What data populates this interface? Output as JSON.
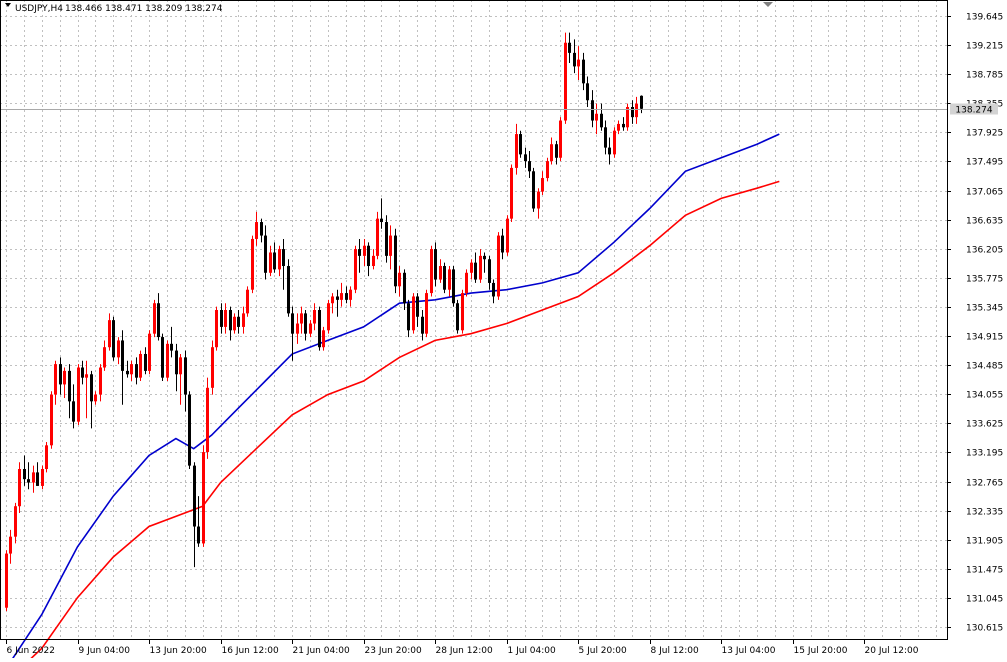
{
  "header": {
    "symbol_tf": "USDJPY,H4",
    "ohlc": "138.466 138.471 138.209 138.274"
  },
  "price_label": {
    "value": "138.274",
    "bg": "#d3d3d3"
  },
  "colors": {
    "bull": "#ff0000",
    "bear": "#000000",
    "ma_fast": "#0000cd",
    "ma_slow": "#ff0000",
    "grid": "#c0c0c0"
  },
  "chart_data": {
    "type": "candlestick",
    "symbol": "USDJPY",
    "timeframe": "H4",
    "ylim": [
      130.4,
      139.85
    ],
    "y_ticks": [
      "139.645",
      "139.215",
      "138.785",
      "138.355",
      "137.925",
      "137.495",
      "137.065",
      "136.635",
      "136.205",
      "135.775",
      "135.345",
      "134.915",
      "134.485",
      "134.055",
      "133.625",
      "133.195",
      "132.765",
      "132.335",
      "131.905",
      "131.475",
      "131.045",
      "130.615"
    ],
    "x_ticks": [
      "6 Jun 2022",
      "9 Jun 04:00",
      "13 Jun 20:00",
      "16 Jun 12:00",
      "21 Jun 04:00",
      "23 Jun 20:00",
      "28 Jun 12:00",
      "1 Jul 04:00",
      "5 Jul 20:00",
      "8 Jul 12:00",
      "13 Jul 04:00",
      "15 Jul 20:00",
      "20 Jul 12:00"
    ],
    "x_tick_bars": [
      0,
      16,
      32,
      48,
      64,
      80,
      96,
      112,
      128,
      144,
      160,
      176,
      192
    ],
    "last_price": 138.274,
    "candles": [
      [
        130.9,
        131.75,
        130.85,
        131.7
      ],
      [
        131.7,
        132.05,
        131.55,
        131.95
      ],
      [
        131.95,
        132.45,
        131.85,
        132.4
      ],
      [
        132.4,
        133.05,
        132.3,
        132.95
      ],
      [
        132.95,
        133.15,
        132.7,
        132.8
      ],
      [
        132.8,
        133.05,
        132.65,
        132.75
      ],
      [
        132.75,
        133.0,
        132.6,
        132.9
      ],
      [
        132.9,
        133.05,
        132.7,
        132.7
      ],
      [
        132.7,
        133.0,
        132.65,
        132.95
      ],
      [
        132.95,
        133.35,
        132.9,
        133.3
      ],
      [
        133.3,
        134.1,
        133.25,
        134.05
      ],
      [
        134.05,
        134.55,
        133.9,
        134.5
      ],
      [
        134.5,
        134.6,
        134.05,
        134.2
      ],
      [
        134.2,
        134.45,
        134.0,
        134.4
      ],
      [
        134.4,
        134.5,
        133.7,
        133.95
      ],
      [
        133.95,
        134.2,
        133.55,
        133.65
      ],
      [
        133.65,
        134.5,
        133.6,
        134.45
      ],
      [
        134.45,
        134.55,
        134.2,
        134.3
      ],
      [
        134.3,
        134.55,
        133.7,
        134.35
      ],
      [
        134.35,
        134.4,
        133.55,
        133.95
      ],
      [
        133.95,
        134.1,
        133.9,
        134.05
      ],
      [
        134.05,
        134.5,
        133.95,
        134.45
      ],
      [
        134.45,
        134.85,
        134.4,
        134.75
      ],
      [
        134.75,
        135.25,
        134.7,
        135.15
      ],
      [
        135.15,
        135.2,
        134.55,
        134.6
      ],
      [
        134.6,
        134.9,
        134.5,
        134.85
      ],
      [
        134.85,
        135.0,
        133.9,
        134.4
      ],
      [
        134.4,
        134.55,
        134.3,
        134.35
      ],
      [
        134.35,
        134.55,
        134.25,
        134.5
      ],
      [
        134.5,
        134.6,
        134.2,
        134.3
      ],
      [
        134.3,
        134.7,
        134.25,
        134.65
      ],
      [
        134.65,
        134.75,
        134.35,
        134.4
      ],
      [
        134.4,
        135.0,
        134.35,
        134.95
      ],
      [
        134.95,
        135.45,
        134.9,
        135.4
      ],
      [
        135.4,
        135.55,
        134.85,
        134.9
      ],
      [
        134.9,
        134.95,
        134.25,
        134.3
      ],
      [
        134.3,
        134.85,
        134.25,
        134.8
      ],
      [
        134.8,
        135.05,
        134.6,
        134.7
      ],
      [
        134.7,
        134.8,
        134.1,
        134.35
      ],
      [
        134.35,
        134.65,
        133.9,
        134.6
      ],
      [
        134.6,
        134.7,
        133.8,
        134.05
      ],
      [
        134.05,
        134.1,
        132.95,
        133.0
      ],
      [
        133.0,
        133.05,
        131.5,
        132.1
      ],
      [
        132.1,
        132.55,
        131.8,
        131.85
      ],
      [
        131.85,
        133.3,
        131.8,
        133.2
      ],
      [
        133.2,
        134.3,
        133.1,
        134.15
      ],
      [
        134.15,
        134.85,
        134.05,
        134.75
      ],
      [
        134.75,
        135.35,
        134.7,
        135.3
      ],
      [
        135.3,
        135.4,
        134.95,
        135.05
      ],
      [
        135.05,
        135.4,
        134.95,
        135.3
      ],
      [
        135.3,
        135.35,
        134.85,
        135.0
      ],
      [
        135.0,
        135.25,
        134.95,
        135.2
      ],
      [
        135.2,
        135.3,
        134.95,
        135.05
      ],
      [
        135.05,
        135.35,
        134.95,
        135.25
      ],
      [
        135.25,
        135.65,
        135.2,
        135.6
      ],
      [
        135.6,
        136.4,
        135.55,
        136.35
      ],
      [
        136.35,
        136.75,
        136.25,
        136.6
      ],
      [
        136.6,
        136.65,
        136.3,
        136.4
      ],
      [
        136.4,
        136.55,
        135.75,
        135.85
      ],
      [
        135.85,
        136.25,
        135.8,
        136.15
      ],
      [
        136.15,
        136.3,
        135.85,
        135.9
      ],
      [
        135.9,
        136.25,
        135.8,
        136.2
      ],
      [
        136.2,
        136.35,
        135.6,
        135.95
      ],
      [
        135.95,
        136.05,
        135.2,
        135.25
      ],
      [
        135.25,
        135.35,
        134.55,
        134.95
      ],
      [
        134.95,
        135.25,
        134.8,
        135.1
      ],
      [
        135.1,
        135.35,
        134.95,
        135.25
      ],
      [
        135.25,
        135.3,
        134.85,
        134.95
      ],
      [
        134.95,
        135.15,
        134.9,
        135.1
      ],
      [
        135.1,
        135.4,
        135.0,
        135.3
      ],
      [
        135.3,
        135.35,
        134.7,
        134.75
      ],
      [
        134.75,
        135.05,
        134.7,
        135.0
      ],
      [
        135.0,
        135.45,
        134.95,
        135.4
      ],
      [
        135.4,
        135.55,
        135.25,
        135.5
      ],
      [
        135.5,
        135.6,
        135.2,
        135.45
      ],
      [
        135.45,
        135.7,
        135.35,
        135.55
      ],
      [
        135.55,
        135.65,
        135.4,
        135.45
      ],
      [
        135.45,
        135.65,
        135.35,
        135.6
      ],
      [
        135.6,
        136.25,
        135.55,
        136.2
      ],
      [
        136.2,
        136.35,
        135.85,
        136.1
      ],
      [
        136.1,
        136.35,
        135.95,
        136.25
      ],
      [
        136.25,
        136.3,
        135.8,
        135.95
      ],
      [
        135.95,
        136.2,
        135.9,
        136.1
      ],
      [
        136.1,
        136.75,
        136.05,
        136.65
      ],
      [
        136.65,
        136.95,
        136.5,
        136.6
      ],
      [
        136.6,
        136.7,
        136.0,
        136.1
      ],
      [
        136.1,
        136.55,
        135.9,
        136.4
      ],
      [
        136.4,
        136.5,
        135.55,
        135.65
      ],
      [
        135.65,
        135.95,
        135.5,
        135.85
      ],
      [
        135.85,
        135.9,
        135.3,
        135.4
      ],
      [
        135.4,
        135.45,
        134.9,
        135.0
      ],
      [
        135.0,
        135.55,
        134.95,
        135.5
      ],
      [
        135.5,
        135.55,
        135.05,
        135.2
      ],
      [
        135.2,
        135.3,
        134.85,
        134.95
      ],
      [
        134.95,
        135.6,
        134.9,
        135.55
      ],
      [
        135.55,
        136.25,
        135.5,
        136.2
      ],
      [
        136.2,
        136.3,
        135.65,
        135.75
      ],
      [
        135.75,
        136.05,
        135.7,
        135.95
      ],
      [
        135.95,
        136.0,
        135.55,
        135.6
      ],
      [
        135.6,
        135.95,
        135.5,
        135.9
      ],
      [
        135.9,
        135.95,
        135.35,
        135.4
      ],
      [
        135.4,
        135.45,
        134.95,
        135.0
      ],
      [
        135.0,
        135.6,
        134.95,
        135.55
      ],
      [
        135.55,
        135.9,
        135.5,
        135.85
      ],
      [
        135.85,
        136.05,
        135.75,
        136.0
      ],
      [
        136.0,
        136.15,
        135.7,
        135.75
      ],
      [
        135.75,
        136.2,
        135.7,
        136.1
      ],
      [
        136.1,
        136.15,
        135.85,
        136.05
      ],
      [
        136.05,
        136.1,
        135.6,
        135.7
      ],
      [
        135.7,
        135.75,
        135.4,
        135.5
      ],
      [
        135.5,
        136.45,
        135.45,
        136.4
      ],
      [
        136.4,
        136.5,
        136.05,
        136.15
      ],
      [
        136.15,
        136.7,
        136.1,
        136.65
      ],
      [
        136.65,
        137.45,
        136.6,
        137.4
      ],
      [
        137.4,
        138.05,
        137.3,
        137.9
      ],
      [
        137.9,
        137.95,
        137.55,
        137.6
      ],
      [
        137.6,
        137.7,
        137.4,
        137.5
      ],
      [
        137.5,
        137.65,
        137.25,
        137.35
      ],
      [
        137.35,
        137.4,
        136.75,
        136.8
      ],
      [
        136.8,
        137.1,
        136.65,
        137.05
      ],
      [
        137.05,
        137.35,
        137.0,
        137.25
      ],
      [
        137.25,
        137.55,
        137.2,
        137.5
      ],
      [
        137.5,
        137.85,
        137.45,
        137.75
      ],
      [
        137.75,
        137.8,
        137.45,
        137.55
      ],
      [
        137.55,
        138.15,
        137.5,
        138.1
      ],
      [
        138.1,
        139.4,
        138.05,
        139.25
      ],
      [
        139.25,
        139.4,
        138.95,
        139.1
      ],
      [
        139.1,
        139.3,
        138.8,
        138.9
      ],
      [
        138.9,
        139.2,
        138.7,
        139.0
      ],
      [
        139.0,
        139.1,
        138.55,
        138.65
      ],
      [
        138.65,
        138.75,
        138.3,
        138.4
      ],
      [
        138.4,
        138.55,
        138.0,
        138.1
      ],
      [
        138.1,
        138.35,
        137.9,
        138.2
      ],
      [
        138.2,
        138.35,
        137.95,
        138.0
      ],
      [
        138.0,
        138.1,
        137.6,
        137.7
      ],
      [
        137.7,
        137.85,
        137.45,
        137.6
      ],
      [
        137.6,
        138.0,
        137.55,
        137.95
      ],
      [
        137.95,
        138.1,
        137.9,
        138.05
      ],
      [
        138.05,
        138.15,
        137.95,
        138.0
      ],
      [
        138.0,
        138.35,
        137.95,
        138.3
      ],
      [
        138.3,
        138.4,
        138.05,
        138.15
      ],
      [
        138.15,
        138.45,
        138.05,
        138.35
      ],
      [
        138.466,
        138.471,
        138.209,
        138.274
      ]
    ],
    "series": [
      {
        "name": "MA fast",
        "color": "#0000cd",
        "values": [
          [
            0,
            130.0
          ],
          [
            8,
            130.8
          ],
          [
            16,
            131.8
          ],
          [
            24,
            132.55
          ],
          [
            32,
            133.15
          ],
          [
            38,
            133.4
          ],
          [
            42,
            133.25
          ],
          [
            46,
            133.45
          ],
          [
            52,
            133.85
          ],
          [
            58,
            134.25
          ],
          [
            64,
            134.65
          ],
          [
            72,
            134.85
          ],
          [
            80,
            135.05
          ],
          [
            88,
            135.4
          ],
          [
            96,
            135.45
          ],
          [
            104,
            135.55
          ],
          [
            112,
            135.6
          ],
          [
            120,
            135.7
          ],
          [
            128,
            135.85
          ],
          [
            136,
            136.3
          ],
          [
            144,
            136.8
          ],
          [
            152,
            137.35
          ],
          [
            160,
            137.55
          ],
          [
            168,
            137.75
          ],
          [
            173,
            137.9
          ]
        ]
      },
      {
        "name": "MA slow",
        "color": "#ff0000",
        "values": [
          [
            0,
            129.8
          ],
          [
            8,
            130.3
          ],
          [
            16,
            131.05
          ],
          [
            24,
            131.65
          ],
          [
            32,
            132.1
          ],
          [
            40,
            132.3
          ],
          [
            44,
            132.4
          ],
          [
            48,
            132.75
          ],
          [
            56,
            133.25
          ],
          [
            64,
            133.75
          ],
          [
            72,
            134.05
          ],
          [
            80,
            134.25
          ],
          [
            88,
            134.6
          ],
          [
            96,
            134.85
          ],
          [
            104,
            134.95
          ],
          [
            112,
            135.1
          ],
          [
            120,
            135.3
          ],
          [
            128,
            135.5
          ],
          [
            136,
            135.85
          ],
          [
            144,
            136.25
          ],
          [
            152,
            136.7
          ],
          [
            160,
            136.95
          ],
          [
            168,
            137.1
          ],
          [
            173,
            137.2
          ]
        ]
      }
    ]
  }
}
